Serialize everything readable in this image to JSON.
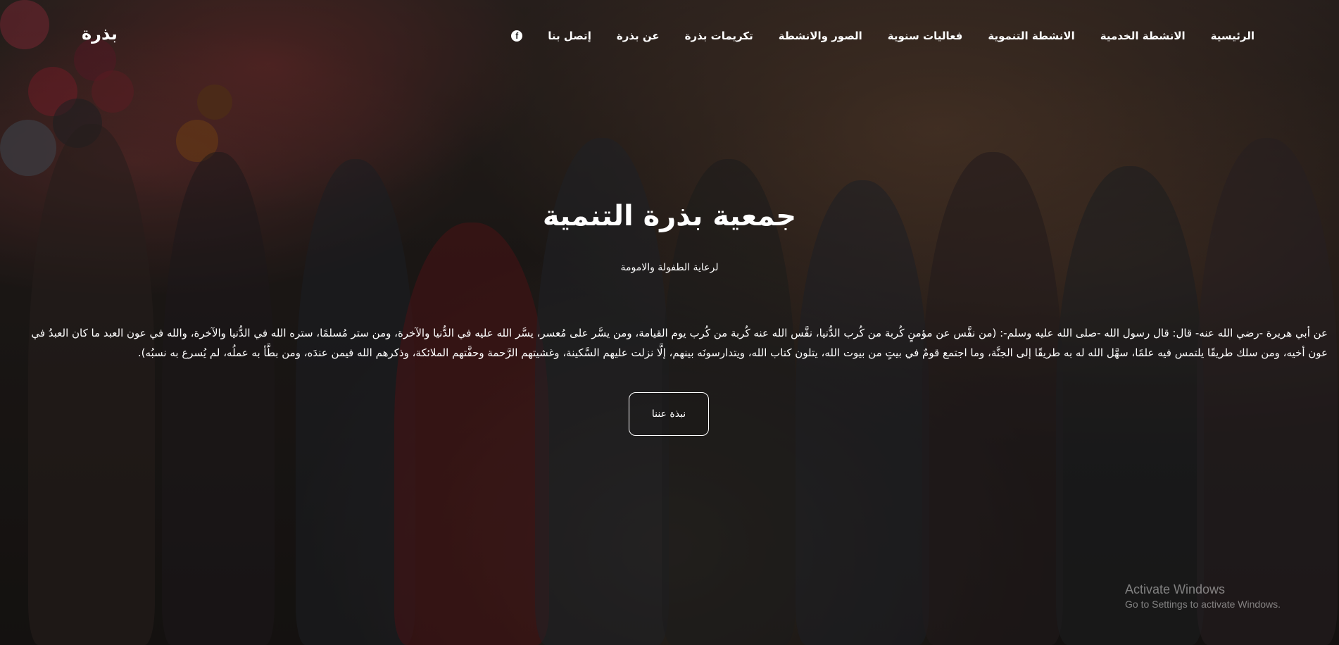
{
  "nav": {
    "brand": "بذرة",
    "items": [
      {
        "label": "الرئيسية"
      },
      {
        "label": "الانشطة الخدمية"
      },
      {
        "label": "الانشطة التنموية"
      },
      {
        "label": "فعاليات سنوية"
      },
      {
        "label": "الصور والانشطة"
      },
      {
        "label": "تكريمات بذرة"
      },
      {
        "label": "عن بذرة"
      },
      {
        "label": "إتصل بنا"
      }
    ],
    "social_icon": "facebook-icon",
    "social_glyph": "f"
  },
  "hero": {
    "title": "جمعية بذرة التنمية",
    "subtitle": "لرعاية الطفولة والامومة",
    "hadith": "عن أبي هريرة -رضي الله عنه- قال: قال رسول الله -صلى الله عليه وسلم-: (من نفَّس عن مؤمنٍ كُربة من كُرب الدُّنيا، نفَّس الله عنه كُربة من كُرب يوم القيامة، ومن يسَّر على مُعسر، يسَّر الله عليه في الدُّنيا والآخرة، ومن ستر مُسلمًا، ستره الله في الدُّنيا والآخرة، والله في عون العبد ما كان العبدُ في عون أخيه، ومن سلك طريقًا يلتمس فيه علمًا، سهَّل الله له به طريقًا إلى الجنَّة، وما اجتمع قومٌ في بيتٍ من بيوت الله، يتلون كتاب الله، ويتدارسونَه بينهم، إلَّا نزلت عليهم السَّكينة، وغشيتهم الرَّحمة وحفَّتهم الملائكة، وذكرهم الله فيمن عندَه، ومن بطَّأ به عملُه، لم يُسرع به نسبُه).",
    "cta": "نبذة عننا"
  },
  "watermark": {
    "line1": "Activate Windows",
    "line2": "Go to Settings to activate Windows."
  }
}
